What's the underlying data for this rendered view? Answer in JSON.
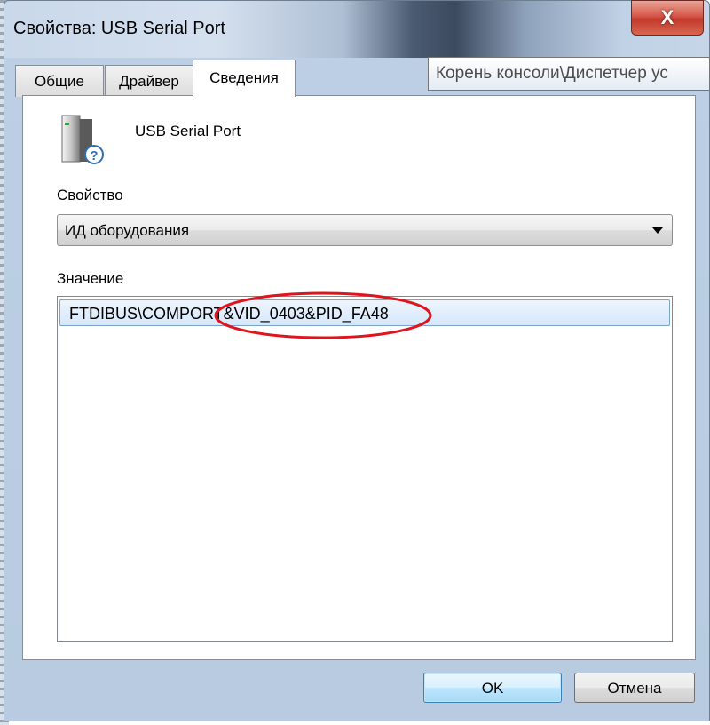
{
  "window": {
    "title": "Свойства: USB Serial Port",
    "close_label": "X"
  },
  "tooltip": {
    "text": "Корень консоли\\Диспетчер ус"
  },
  "tabs": [
    {
      "label": "Общие",
      "active": false
    },
    {
      "label": "Драйвер",
      "active": false
    },
    {
      "label": "Сведения",
      "active": true
    }
  ],
  "device": {
    "name": "USB Serial Port",
    "icon": "device-unknown-icon"
  },
  "property": {
    "label": "Свойство",
    "selected": "ИД оборудования"
  },
  "value": {
    "label": "Значение",
    "items": [
      "FTDIBUS\\COMPORT&VID_0403&PID_FA48"
    ]
  },
  "buttons": {
    "ok": "OK",
    "cancel": "Отмена"
  },
  "colors": {
    "annotation": "#e0141e",
    "selection": "#d5e7fb",
    "close": "#c23a2c"
  }
}
